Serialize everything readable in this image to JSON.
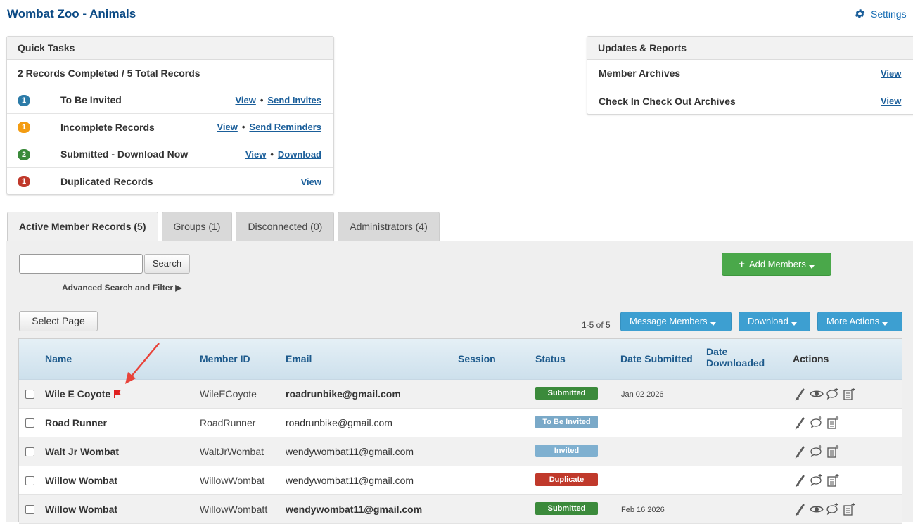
{
  "header": {
    "title": "Wombat Zoo - Animals",
    "settings_label": "Settings"
  },
  "quick_tasks": {
    "title": "Quick Tasks",
    "summary": "2 Records Completed / 5 Total Records",
    "rows": [
      {
        "count": "1",
        "color": "#2c7ba8",
        "label": "To Be Invited",
        "link1": "View",
        "link2": "Send Invites"
      },
      {
        "count": "1",
        "color": "#f39c12",
        "label": "Incomplete Records",
        "link1": "View",
        "link2": "Send Reminders"
      },
      {
        "count": "2",
        "color": "#3a8a3a",
        "label": "Submitted - Download Now",
        "link1": "View",
        "link2": "Download"
      },
      {
        "count": "1",
        "color": "#c0392b",
        "label": "Duplicated Records",
        "link1": "View"
      }
    ]
  },
  "updates": {
    "title": "Updates & Reports",
    "rows": [
      {
        "label": "Member Archives",
        "link": "View"
      },
      {
        "label": "Check In Check Out Archives",
        "link": "View"
      }
    ]
  },
  "tabs": [
    {
      "label": "Active Member Records (5)",
      "active": true
    },
    {
      "label": "Groups (1)"
    },
    {
      "label": "Disconnected (0)"
    },
    {
      "label": "Administrators (4)"
    }
  ],
  "toolbar": {
    "search_button": "Search",
    "advanced": "Advanced Search and Filter ▶",
    "add_members": "Add Members",
    "select_page": "Select Page",
    "count": "1-5 of 5",
    "message_members": "Message Members",
    "download": "Download",
    "more_actions": "More Actions"
  },
  "table": {
    "headers": {
      "name": "Name",
      "member_id": "Member ID",
      "email": "Email",
      "session": "Session",
      "status": "Status",
      "date_submitted": "Date Submitted",
      "date_downloaded_1": "Date",
      "date_downloaded_2": "Downloaded",
      "actions": "Actions"
    },
    "rows": [
      {
        "name": "Wile E Coyote",
        "member_id": "WileECoyote",
        "email": "roadrunbike@gmail.com",
        "status": "Submitted",
        "date_submitted": "Jan 02 2026",
        "flagged": true
      },
      {
        "name": "Road Runner",
        "member_id": "RoadRunner",
        "email": "roadrunbike@gmail.com",
        "status": "To Be Invited",
        "date_submitted": ""
      },
      {
        "name": "Walt Jr Wombat",
        "member_id": "WaltJrWombat",
        "email": "wendywombat11@gmail.com",
        "status": "Invited",
        "date_submitted": ""
      },
      {
        "name": "Willow Wombat",
        "member_id": "WillowWombat",
        "email": "wendywombat11@gmail.com",
        "status": "Duplicate",
        "date_submitted": ""
      },
      {
        "name": "Willow Wombat",
        "member_id": "WillowWombatt",
        "email": "wendywombat11@gmail.com",
        "status": "Submitted",
        "date_submitted": "Feb 16 2026"
      }
    ]
  },
  "colors": {
    "accent": "#0b4a85",
    "add_button": "#4aa84a",
    "action_buttons": "#3d9fd1",
    "annotation_arrow": "#e8433a"
  },
  "icons": [
    "gear-icon",
    "plus-icon",
    "caret-down-icon",
    "flag-icon",
    "edit-pen-icon",
    "view-eye-icon",
    "add-comment-icon",
    "add-note-icon"
  ]
}
